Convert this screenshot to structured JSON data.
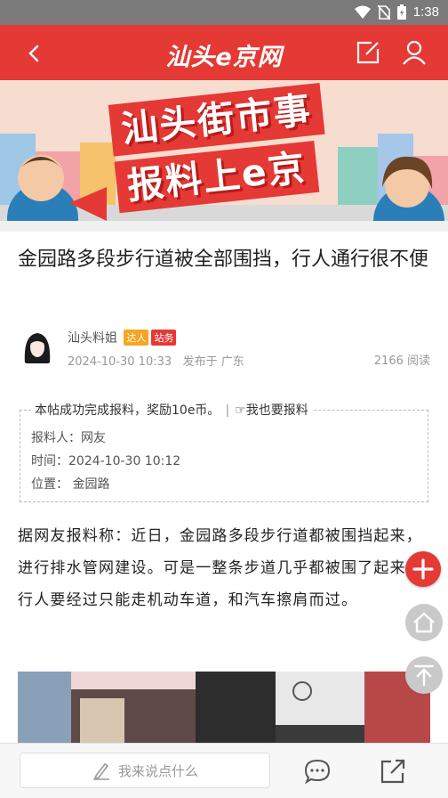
{
  "status_bar": {
    "time": "1:38"
  },
  "app_bar": {
    "logo": "汕头e京网"
  },
  "banner": {
    "line1": "汕头街市事",
    "line2": "报料上e京"
  },
  "article": {
    "title": "金园路多段步行道被全部围挡，行人通行很不便",
    "author": {
      "name": "汕头料姐",
      "badges": [
        "达人",
        "站务"
      ],
      "date": "2024-10-30 10:33",
      "location": "发布于 广东",
      "views": "2166 阅读"
    },
    "report_box": {
      "header": "本帖成功完成报料，奖励10e币。",
      "link": "☞我也要报料",
      "lines": [
        "报料人：网友",
        "时间：2024-10-30 10:12",
        "位置：  金园路"
      ]
    },
    "body": "据网友报料称：近日，金园路多段步行道都被围挡起来，进行排水管网建设。可是一整条步道几乎都被围了起来，行人要经过只能走机动车道，和汽车擦肩而过。"
  },
  "bottom_bar": {
    "comment_placeholder": "我来说点什么"
  },
  "colors": {
    "brand_red": "#e53935",
    "fab_gray": "#c9c9c9",
    "badge_orange": "#f5a623"
  }
}
